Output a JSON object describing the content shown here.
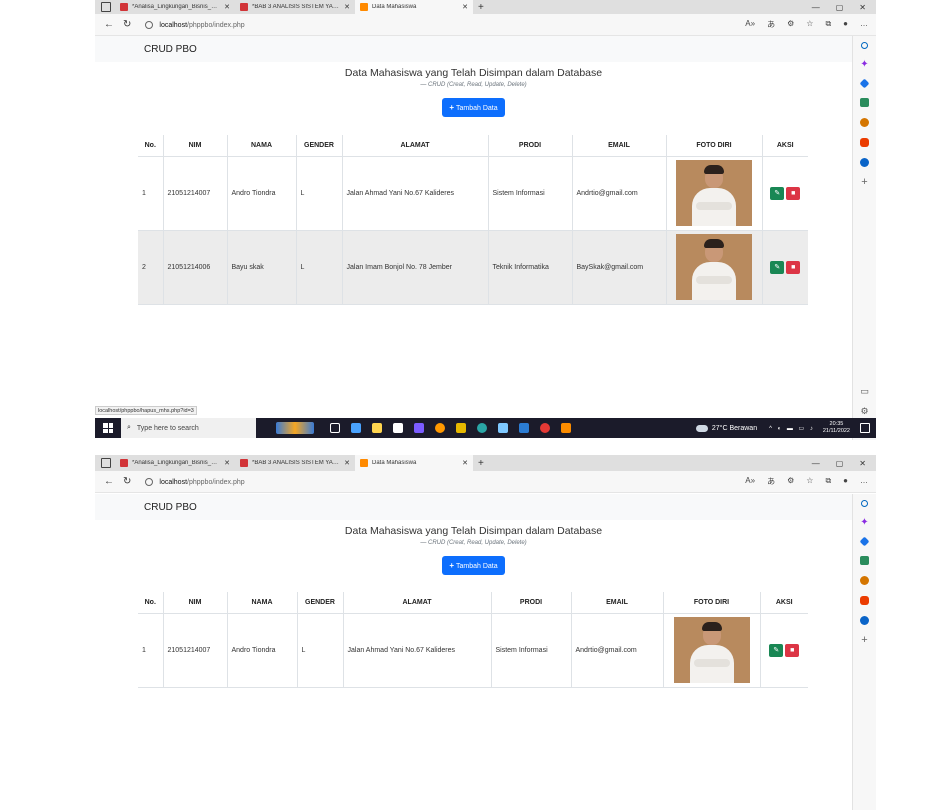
{
  "browser": {
    "tabs": [
      {
        "label": "*Analisa_Lingkungan_Bisnis_Gra",
        "icon": "pdf-icon"
      },
      {
        "label": "*BAB 3 ANALISIS SISTEM YANG",
        "icon": "pdf-icon"
      },
      {
        "label": "Data Mahasiswa",
        "icon": "xampp-icon"
      }
    ],
    "new_tab": "+",
    "url_host": "localhost",
    "url_path": "/phppbo/index.php"
  },
  "navbar": {
    "brand": "CRUD PBO"
  },
  "page": {
    "heading": "Data Mahasiswa yang Telah Disimpan dalam Database",
    "subheading": "— CRUD (Creat, Read, Update, Delete)",
    "add_button": "Tambah Data"
  },
  "table": {
    "headers": [
      "No.",
      "NIM",
      "NAMA",
      "GENDER",
      "ALAMAT",
      "PRODI",
      "EMAIL",
      "FOTO DIRI",
      "AKSI"
    ],
    "rows_before": [
      {
        "no": "1",
        "nim": "21051214007",
        "nama": "Andro Tiondra",
        "gender": "L",
        "alamat": "Jalan Ahmad Yani No.67 Kalideres",
        "prodi": "Sistem Informasi",
        "email": "Andrtio@gmail.com"
      },
      {
        "no": "2",
        "nim": "21051214006",
        "nama": "Bayu skak",
        "gender": "L",
        "alamat": "Jalan Imam Bonjol No. 78 Jember",
        "prodi": "Teknik Informatika",
        "email": "BaySkak@gmail.com"
      }
    ],
    "rows_after": [
      {
        "no": "1",
        "nim": "21051214007",
        "nama": "Andro Tiondra",
        "gender": "L",
        "alamat": "Jalan Ahmad Yani No.67 Kalideres",
        "prodi": "Sistem Informasi",
        "email": "Andrtio@gmail.com"
      }
    ]
  },
  "status_url": "localhost/phppbo/hapus_mhs.php?id=3",
  "taskbar": {
    "search_placeholder": "Type here to search",
    "weather": "27°C  Berawan",
    "time": "20:35",
    "date": "21/11/2022"
  },
  "colors": {
    "primary": "#0d6efd",
    "success": "#198754",
    "danger": "#dc3545",
    "taskbar": "#1b1b2a"
  }
}
